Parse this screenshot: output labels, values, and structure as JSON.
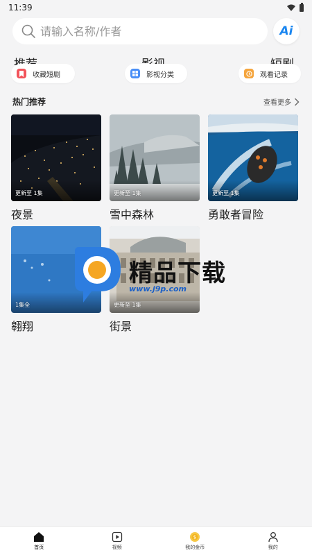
{
  "status": {
    "time": "11:39"
  },
  "search": {
    "placeholder": "请输入名称/作者",
    "ai_label": "Ai"
  },
  "tabs": [
    {
      "label": "推荐"
    },
    {
      "label": "影视"
    },
    {
      "label": "短剧"
    }
  ],
  "quick_links": [
    {
      "label": "收藏短剧",
      "icon": "bookmark-icon",
      "color": "#f2545b"
    },
    {
      "label": "影视分类",
      "icon": "grid-icon",
      "color": "#4a8ff7"
    },
    {
      "label": "观看记录",
      "icon": "history-icon",
      "color": "#f5a53d"
    }
  ],
  "section": {
    "title": "热门推荐",
    "more": "查看更多"
  },
  "cards": [
    {
      "title": "夜景",
      "badge": "更新至 1集"
    },
    {
      "title": "雪中森林",
      "badge": "更新至 1集"
    },
    {
      "title": "勇敢者冒险",
      "badge": "更新至 1集"
    },
    {
      "title": "翱翔",
      "badge": "1集全"
    },
    {
      "title": "街景",
      "badge": "更新至 1集"
    }
  ],
  "watermark": {
    "text": "精品下载",
    "url": "www.j9p.com"
  },
  "bottom_nav": [
    {
      "label": "首页",
      "icon": "home-icon"
    },
    {
      "label": "视频",
      "icon": "video-icon"
    },
    {
      "label": "我的金币",
      "icon": "coin-icon"
    },
    {
      "label": "我的",
      "icon": "user-icon"
    }
  ],
  "colors": {
    "accent": "#1a86f0",
    "background": "#f4f4f5"
  }
}
